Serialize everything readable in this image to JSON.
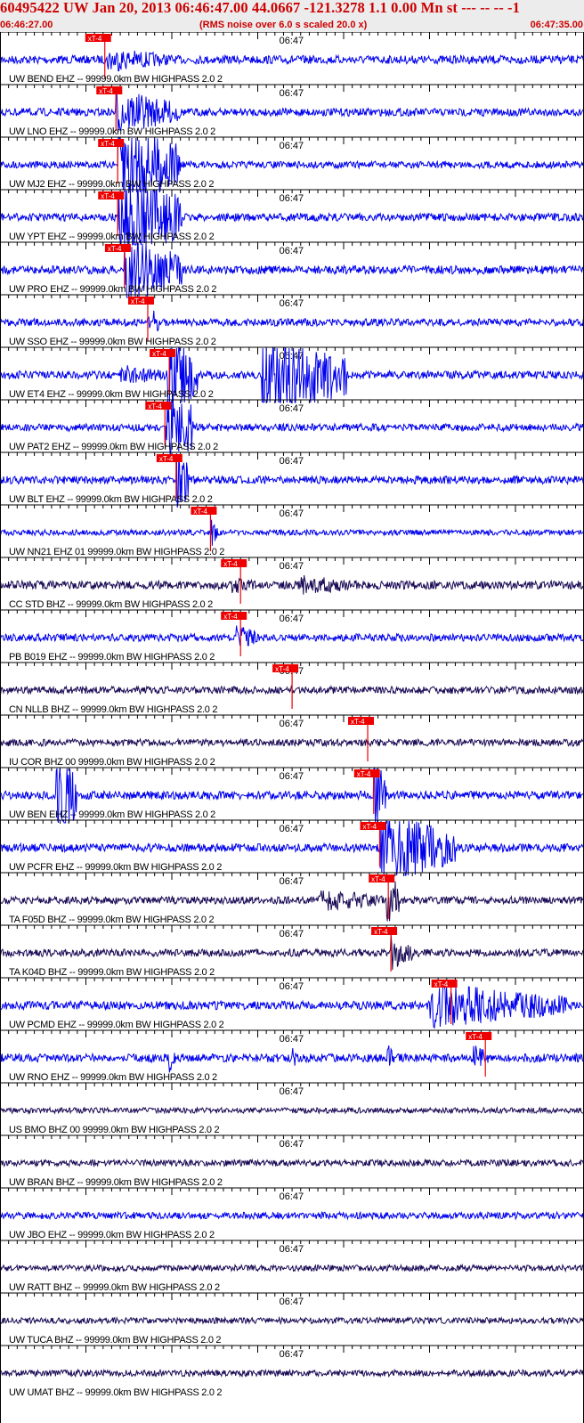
{
  "header": {
    "title": "60495422 UW Jan 20, 2013 06:46:47.00   44.0667 -121.3278  1.1 0.00 Mn st --- -- --  -1",
    "start_time": "06:46:27.00",
    "rms_note": "(RMS noise over 6.0 s scaled 20.0 x)",
    "end_time": "06:47:35.00"
  },
  "chart_data": {
    "type": "line",
    "title": "60495422 UW Jan 20, 2013 06:46:47.00   44.0667 -121.3278  1.1 0.00 Mn st --- -- --  -1",
    "x_range": [
      "06:46:27.00",
      "06:47:35.00"
    ],
    "tick_label": "06:47",
    "pick_label": "xT-4",
    "trace_count": 27,
    "colors": {
      "blue": "#0000ee",
      "dark": "#1a0a55",
      "pick": "#ee0000",
      "text": "#000000"
    },
    "traces": [
      {
        "label": "UW BEND EHZ -- 99999.0km BW  HIGHPASS  2.0  2",
        "pick_s": 12.2,
        "color": "blue",
        "noise": 0.18,
        "events": [
          {
            "s": 12.5,
            "e": 20,
            "a": 0.55
          }
        ]
      },
      {
        "label": "UW LNO EHZ -- 99999.0km BW  HIGHPASS  2.0  2",
        "pick_s": 13.5,
        "color": "blue",
        "noise": 0.17,
        "events": [
          {
            "s": 13.5,
            "e": 21,
            "a": 1.0
          }
        ]
      },
      {
        "label": "UW MJ2 EHZ -- 99999.0km BW  HIGHPASS  2.0  2",
        "pick_s": 13.7,
        "color": "blue",
        "noise": 0.15,
        "events": [
          {
            "s": 13.7,
            "e": 21,
            "a": 2.2
          }
        ]
      },
      {
        "label": "UW YPT EHZ -- 99999.0km BW  HIGHPASS  2.0  2",
        "pick_s": 13.7,
        "color": "blue",
        "noise": 0.17,
        "events": [
          {
            "s": 13.7,
            "e": 21.2,
            "a": 2.2
          }
        ]
      },
      {
        "label": "UW PRO EHZ -- 99999.0km BW  HIGHPASS  2.0  2",
        "pick_s": 14.5,
        "color": "blue",
        "noise": 0.18,
        "events": [
          {
            "s": 14.5,
            "e": 21.2,
            "a": 1.6
          }
        ]
      },
      {
        "label": "UW SSO EHZ -- 99999.0km BW  HIGHPASS  2.0  2",
        "pick_s": 17.2,
        "color": "blue",
        "noise": 0.16,
        "events": [
          {
            "s": 17.2,
            "e": 18.5,
            "a": 0.8
          }
        ]
      },
      {
        "label": "UW ET4 EHZ -- 99999.0km BW  HIGHPASS  2.0  2",
        "pick_s": 19.7,
        "color": "blue",
        "noise": 0.17,
        "events": [
          {
            "s": 14,
            "e": 19.5,
            "a": 0.5
          },
          {
            "s": 19.5,
            "e": 23,
            "a": 2.2
          },
          {
            "s": 30.5,
            "e": 40.3,
            "a": 2.2
          }
        ]
      },
      {
        "label": "UW PAT2 EHZ -- 99999.0km BW  HIGHPASS  2.0  2",
        "pick_s": 19.2,
        "color": "blue",
        "noise": 0.16,
        "events": [
          {
            "s": 19.2,
            "e": 22.5,
            "a": 2.2
          }
        ]
      },
      {
        "label": "UW BLT EHZ -- 99999.0km BW  HIGHPASS  2.0  2",
        "pick_s": 20.5,
        "color": "blue",
        "noise": 0.17,
        "events": [
          {
            "s": 20.5,
            "e": 22,
            "a": 1.6
          }
        ]
      },
      {
        "label": "UW NN21 EHZ 01 99999.0km BW  HIGHPASS  2.0  2",
        "pick_s": 24.5,
        "color": "blue",
        "noise": 0.12,
        "events": [
          {
            "s": 24.5,
            "e": 25.5,
            "a": 0.7
          }
        ]
      },
      {
        "label": "CC STD BHZ -- 99999.0km BW  HIGHPASS  2.0  2",
        "pick_s": 28.0,
        "color": "dark",
        "noise": 0.18,
        "events": [
          {
            "s": 27,
            "e": 30,
            "a": 0.4
          },
          {
            "s": 35,
            "e": 42,
            "a": 0.45
          }
        ]
      },
      {
        "label": "PB B019 EHZ -- 99999.0km BW  HIGHPASS  2.0  2",
        "pick_s": 28.0,
        "color": "blue",
        "noise": 0.16,
        "events": [
          {
            "s": 27.5,
            "e": 30,
            "a": 0.6
          }
        ]
      },
      {
        "label": "CN NLLB BHZ -- 99999.0km BW  HIGHPASS  2.0  2",
        "pick_s": 34.0,
        "color": "dark",
        "noise": 0.16,
        "events": []
      },
      {
        "label": "IU COR BHZ 00 99999.0km BW  HIGHPASS  2.0  2",
        "pick_s": 42.8,
        "color": "dark",
        "noise": 0.15,
        "events": []
      },
      {
        "label": "UW BEN EHZ -- 99999.0km BW  HIGHPASS  2.0  2",
        "pick_s": 43.5,
        "color": "blue",
        "noise": 0.18,
        "events": [
          {
            "s": 6.5,
            "e": 9,
            "a": 2.2
          },
          {
            "s": 43.5,
            "e": 45,
            "a": 2.2
          }
        ]
      },
      {
        "label": "UW PCFR EHZ -- 99999.0km BW  HIGHPASS  2.0  2",
        "pick_s": 44.2,
        "color": "blue",
        "noise": 0.18,
        "events": [
          {
            "s": 44.2,
            "e": 53,
            "a": 1.7
          }
        ]
      },
      {
        "label": "TA F05D BHZ -- 99999.0km BW  HIGHPASS  2.0  2",
        "pick_s": 45.2,
        "color": "dark",
        "noise": 0.16,
        "events": [
          {
            "s": 37,
            "e": 45,
            "a": 0.5
          },
          {
            "s": 45,
            "e": 46.5,
            "a": 1.4
          }
        ]
      },
      {
        "label": "TA K04D BHZ -- 99999.0km BW  HIGHPASS  2.0  2",
        "pick_s": 45.5,
        "color": "dark",
        "noise": 0.16,
        "events": [
          {
            "s": 45.5,
            "e": 48,
            "a": 0.8
          }
        ]
      },
      {
        "label": "UW PCMD EHZ -- 99999.0km BW  HIGHPASS  2.0  2",
        "pick_s": 52.5,
        "color": "blue",
        "noise": 0.18,
        "events": [
          {
            "s": 50,
            "e": 66,
            "a": 1.0
          }
        ]
      },
      {
        "label": "UW RNO EHZ -- 99999.0km BW  HIGHPASS  2.0  2",
        "pick_s": 56.5,
        "color": "blue",
        "noise": 0.18,
        "events": [
          {
            "s": 19.5,
            "e": 20.5,
            "a": 0.8
          },
          {
            "s": 34,
            "e": 34.5,
            "a": 0.6
          },
          {
            "s": 45,
            "e": 46,
            "a": 0.7
          },
          {
            "s": 55,
            "e": 57,
            "a": 0.6
          }
        ]
      },
      {
        "label": "US BMO BHZ 00 99999.0km BW  HIGHPASS  2.0  2",
        "pick_s": null,
        "color": "dark",
        "noise": 0.12,
        "events": []
      },
      {
        "label": "UW BRAN BHZ -- 99999.0km BW  HIGHPASS  2.0  2",
        "pick_s": null,
        "color": "dark",
        "noise": 0.14,
        "events": []
      },
      {
        "label": "UW JBO EHZ -- 99999.0km BW  HIGHPASS  2.0  2",
        "pick_s": null,
        "color": "blue",
        "noise": 0.15,
        "events": []
      },
      {
        "label": "UW RATT BHZ -- 99999.0km BW  HIGHPASS  2.0  2",
        "pick_s": null,
        "color": "dark",
        "noise": 0.13,
        "events": []
      },
      {
        "label": "UW TUCA BHZ -- 99999.0km BW  HIGHPASS  2.0  2",
        "pick_s": null,
        "color": "dark",
        "noise": 0.13,
        "events": []
      },
      {
        "label": "UW UMAT BHZ -- 99999.0km BW  HIGHPASS  2.0  2",
        "pick_s": null,
        "color": "dark",
        "noise": 0.14,
        "events": []
      }
    ]
  }
}
